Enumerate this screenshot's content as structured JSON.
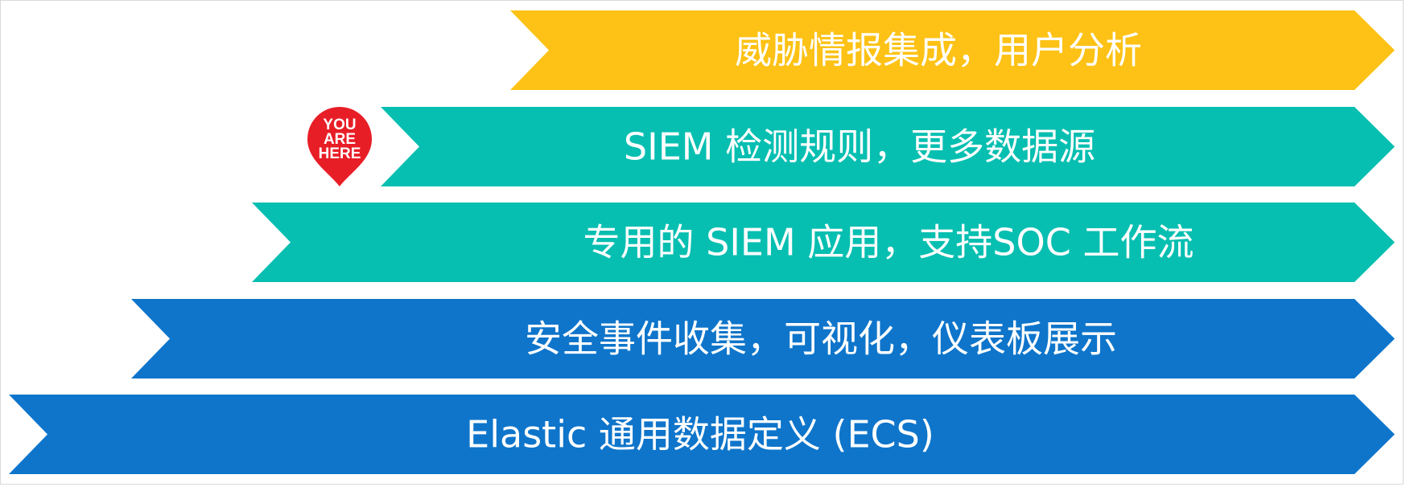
{
  "layers": [
    {
      "label": "威胁情报集成，用户分析",
      "color": "#FDC215"
    },
    {
      "label": "SIEM 检测规则，更多数据源",
      "color": "#07BFB1"
    },
    {
      "label": "专用的 SIEM 应用，支持SOC 工作流",
      "color": "#07BFB1"
    },
    {
      "label": "安全事件收集，可视化，仪表板展示",
      "color": "#0E75CB"
    },
    {
      "label": "Elastic 通用数据定义 (ECS)",
      "color": "#0E75CB"
    }
  ],
  "marker": {
    "lines": [
      "YOU",
      "ARE",
      "HERE"
    ],
    "color": "#E81E27",
    "layer_index": 1
  }
}
